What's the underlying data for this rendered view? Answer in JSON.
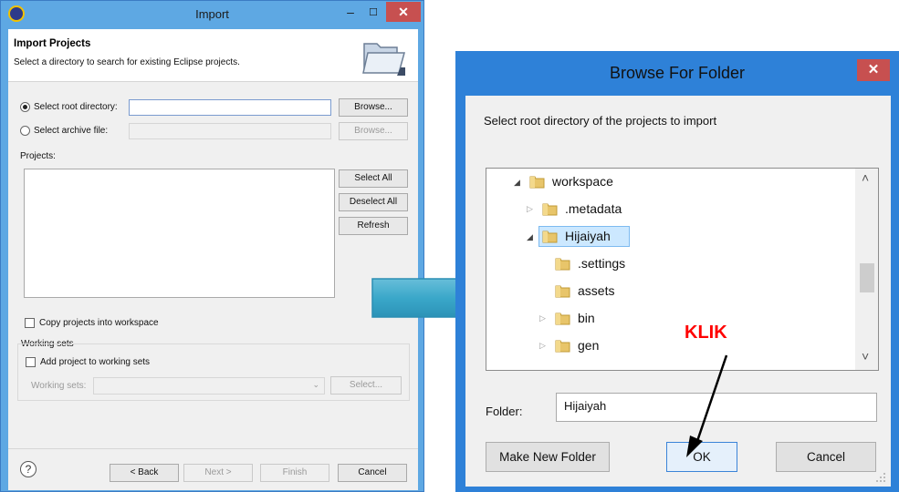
{
  "import_dialog": {
    "title": "Import",
    "header_title": "Import Projects",
    "header_desc": "Select a directory to search for existing Eclipse projects.",
    "radio_root": "Select root directory:",
    "radio_archive": "Select archive file:",
    "browse_root": "Browse...",
    "browse_archive": "Browse...",
    "projects_label": "Projects:",
    "select_all": "Select All",
    "deselect_all": "Deselect All",
    "refresh": "Refresh",
    "copy_projects": "Copy projects into workspace",
    "working_sets_group": "Working sets",
    "add_to_working_sets": "Add project to working sets",
    "working_sets_label": "Working sets:",
    "select_btn": "Select...",
    "back": "< Back",
    "next": "Next >",
    "finish": "Finish",
    "cancel": "Cancel",
    "help": "?",
    "min": "–",
    "max": "☐",
    "close": "✕"
  },
  "browse_dialog": {
    "title": "Browse For Folder",
    "close": "✕",
    "description": "Select root directory of the projects to import",
    "tree": [
      {
        "label": "workspace",
        "expander": "◢",
        "expanded": true
      },
      {
        "label": ".metadata",
        "expander": "▷",
        "expanded": false
      },
      {
        "label": "Hijaiyah",
        "expander": "◢",
        "expanded": true,
        "selected": true
      },
      {
        "label": ".settings",
        "expander": "",
        "expanded": false
      },
      {
        "label": "assets",
        "expander": "",
        "expanded": false
      },
      {
        "label": "bin",
        "expander": "▷",
        "expanded": false
      },
      {
        "label": "gen",
        "expander": "▷",
        "expanded": false
      }
    ],
    "scroll_up": "˄",
    "scroll_down": "˅",
    "folder_label": "Folder:",
    "folder_value": "Hijaiyah",
    "make_new_folder": "Make New Folder",
    "ok": "OK",
    "cancel": "Cancel"
  },
  "annotation": {
    "text": "KLIK",
    "color": "#ff0000"
  },
  "colors": {
    "window_frame": "#5ea8e3",
    "browse_frame": "#2e81d8",
    "close_button": "#c75050",
    "selection": "#cce8ff"
  }
}
